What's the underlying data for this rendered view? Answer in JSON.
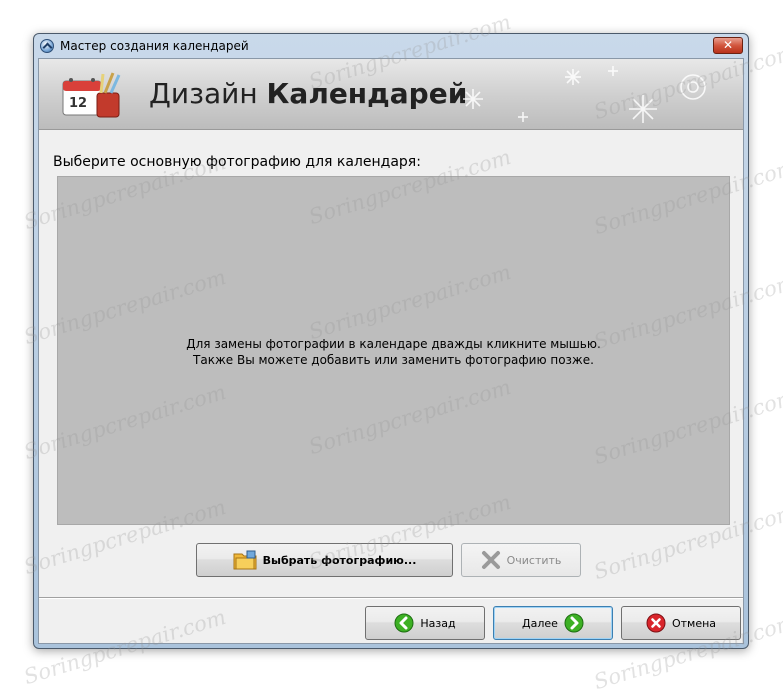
{
  "window": {
    "title": "Мастер создания календарей",
    "close_glyph": "✕"
  },
  "banner": {
    "title_regular": "Дизайн ",
    "title_bold": "Календарей",
    "calendar_day": "12"
  },
  "main": {
    "prompt": "Выберите основную фотографию для календаря:",
    "hint_line1": "Для замены фотографии в календаре дважды кликните мышью.",
    "hint_line2": "Также Вы можете добавить или заменить фотографию позже.",
    "choose_photo_label": "Выбрать фотографию...",
    "clear_label": "Очистить"
  },
  "footer": {
    "back_label": "Назад",
    "next_label": "Далее",
    "cancel_label": "Отмена"
  },
  "watermark_text": "Soringpcrepair.com",
  "colors": {
    "photo_area": "#bdbdbd",
    "client_bg": "#f0f0f0",
    "title_close": "#c8402a",
    "green_arrow": "#3db024",
    "red_cancel": "#d9252b"
  }
}
